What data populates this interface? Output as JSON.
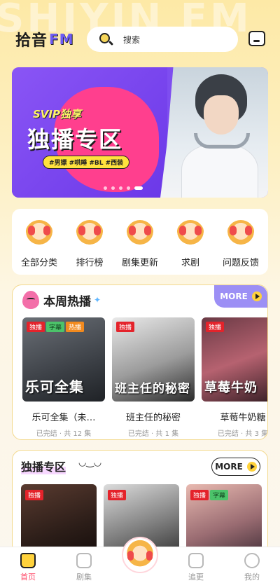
{
  "header": {
    "logo_main": "拾音",
    "logo_fm": "FM",
    "watermark": "SHIYIN FM",
    "search_placeholder": "搜索"
  },
  "banner": {
    "tag": "SVIP独享",
    "title": "独播专区",
    "tags": "#男嫖 #哄睡 #BL #西装",
    "page_count": 5,
    "active_index": 4
  },
  "categories": [
    {
      "label": "全部分类",
      "icon": "books-mascot-icon"
    },
    {
      "label": "排行榜",
      "icon": "trophy-icon"
    },
    {
      "label": "剧集更新",
      "icon": "calendar-mascot-icon"
    },
    {
      "label": "求剧",
      "icon": "headphone-mascot-icon"
    },
    {
      "label": "问题反馈",
      "icon": "feedback-mascot-icon"
    }
  ],
  "weekly_hot": {
    "title": "本周热播",
    "more_label": "MORE",
    "items": [
      {
        "title": "乐可全集（未…",
        "meta": "已完结 · 共 12 集",
        "cover_text": "乐可全集",
        "badges": [
          "独播",
          "字幕",
          "热播"
        ]
      },
      {
        "title": "班主任的秘密",
        "meta": "已完结 · 共 1 集",
        "cover_text": "班主任的秘密",
        "badges": [
          "独播"
        ]
      },
      {
        "title": "草莓牛奶糖",
        "meta": "已完结 · 共 3 集",
        "cover_text": "草莓牛奶",
        "badges": [
          "独播"
        ]
      }
    ]
  },
  "exclusive": {
    "title": "独播专区",
    "more_label": "MORE",
    "items": [
      {
        "badges": [
          "独播"
        ]
      },
      {
        "badges": [
          "独播"
        ]
      },
      {
        "badges": [
          "独播",
          "字幕"
        ]
      }
    ]
  },
  "tabbar": {
    "tabs": [
      {
        "label": "首页",
        "active": true
      },
      {
        "label": "剧集",
        "active": false
      },
      {
        "label": "",
        "active": false
      },
      {
        "label": "追更",
        "active": false
      },
      {
        "label": "我的",
        "active": false
      }
    ]
  },
  "colors": {
    "accent_pink": "#ff4f6e",
    "badge_red": "#e4232b",
    "more_purple": "#9c8ff5",
    "banner_purple": "#7e4df0",
    "banner_pink": "#ff3f8e"
  }
}
